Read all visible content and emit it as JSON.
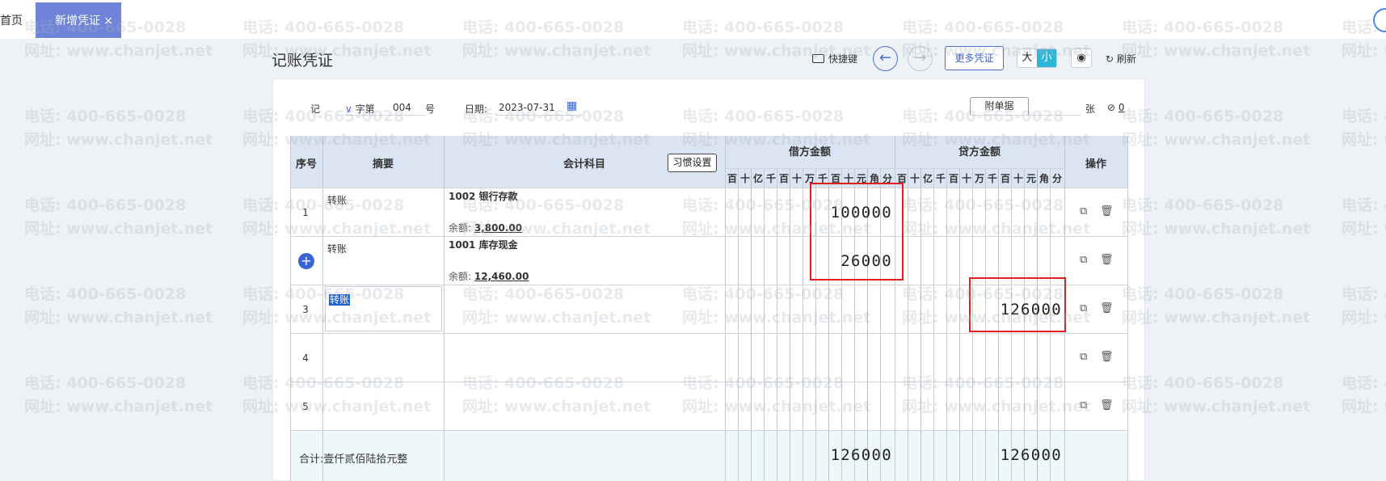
{
  "tabs": {
    "home": "首页",
    "active": "新增凭证",
    "close": "×"
  },
  "header": {
    "title": "记账凭证",
    "shortcut": "快捷键",
    "prev": "←",
    "next": "→",
    "more_voucher": "更多凭证",
    "size_large": "大",
    "size_small": "小",
    "eye": "◉",
    "refresh": "刷新"
  },
  "meta": {
    "voucher_type": "记",
    "zi": "字第",
    "number": "004",
    "hao": "号",
    "date_label": "日期:",
    "date_value": "2023-07-31",
    "attach_button": "附单据",
    "zhang": "张",
    "attach_count": "0"
  },
  "table": {
    "columns": {
      "seq": "序号",
      "summary": "摘要",
      "account": "会计科目",
      "habit": "习惯设置",
      "debit": "借方金额",
      "credit": "贷方金额",
      "ops": "操作"
    },
    "digits": [
      "百",
      "十",
      "亿",
      "千",
      "百",
      "十",
      "万",
      "千",
      "百",
      "十",
      "元",
      "角",
      "分"
    ],
    "rows": [
      {
        "no": "1",
        "summary": "转账",
        "account": "1002 银行存款",
        "balance_label": "余额:",
        "balance": "3,800.00",
        "debit": "100000",
        "credit": ""
      },
      {
        "no": "",
        "summary": "转账",
        "account": "1001 库存现金",
        "balance_label": "余额:",
        "balance": "12,460.00",
        "debit": "26000",
        "credit": ""
      },
      {
        "no": "3",
        "summary": "转账",
        "account": "",
        "balance_label": "",
        "balance": "",
        "debit": "",
        "credit": "126000"
      },
      {
        "no": "4",
        "summary": "",
        "account": "",
        "balance_label": "",
        "balance": "",
        "debit": "",
        "credit": ""
      },
      {
        "no": "5",
        "summary": "",
        "account": "",
        "balance_label": "",
        "balance": "",
        "debit": "",
        "credit": ""
      }
    ],
    "total_label": "合计:",
    "total_words": "壹仟贰佰陆拾元整",
    "total_debit": "126000",
    "total_credit": "126000"
  },
  "watermark": {
    "phone": "电话: 400-665-0028",
    "site": "网址: www.chanjet.net"
  }
}
